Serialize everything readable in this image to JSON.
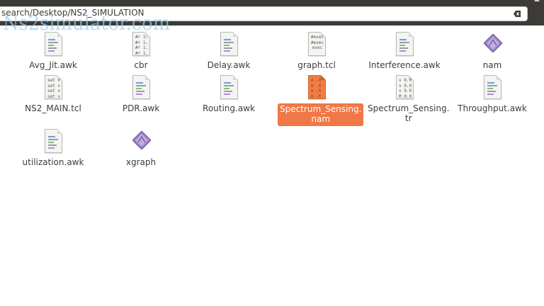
{
  "location": {
    "path": "search/Desktop/NS2_SIMULATION",
    "watermark": "Ns2simulator.com"
  },
  "files": [
    {
      "name": "Avg_Jit.awk",
      "icon": "text-file-icon",
      "preview": ""
    },
    {
      "name": "cbr",
      "icon": "text-file-icon",
      "preview": "#r 1.\n#r 1.\n#r 1.\n#r 1."
    },
    {
      "name": "Delay.awk",
      "icon": "text-file-icon",
      "preview": ""
    },
    {
      "name": "graph.tcl",
      "icon": "text-file-icon",
      "preview": "#exec\n#exec\nexec"
    },
    {
      "name": "Interference.awk",
      "icon": "text-file-icon",
      "preview": ""
    },
    {
      "name": "nam",
      "icon": "executable-icon",
      "preview": ""
    },
    {
      "name": "NS2_MAIN.tcl",
      "icon": "text-file-icon",
      "preview": "set v\nset v\nset v\nset v"
    },
    {
      "name": "PDR.awk",
      "icon": "text-file-icon",
      "preview": ""
    },
    {
      "name": "Routing.awk",
      "icon": "text-file-icon",
      "preview": ""
    },
    {
      "name": "Spectrum_Sensing.\nnam",
      "icon": "text-file-icon",
      "preview": "n -t\nn -t\nn -t\nn -t",
      "selected": true
    },
    {
      "name": "Spectrum_Sensing.\ntr",
      "icon": "text-file-icon",
      "preview": "v 9.9\nv 9.9\nv 9.9\nM 0.0"
    },
    {
      "name": "Throughput.awk",
      "icon": "text-file-icon",
      "preview": ""
    },
    {
      "name": "utilization.awk",
      "icon": "text-file-icon",
      "preview": ""
    },
    {
      "name": "xgraph",
      "icon": "executable-icon",
      "preview": ""
    }
  ],
  "colors": {
    "selection": "#f07746",
    "topbar": "#3c3b37",
    "exec_icon": "#9b7fc2"
  }
}
